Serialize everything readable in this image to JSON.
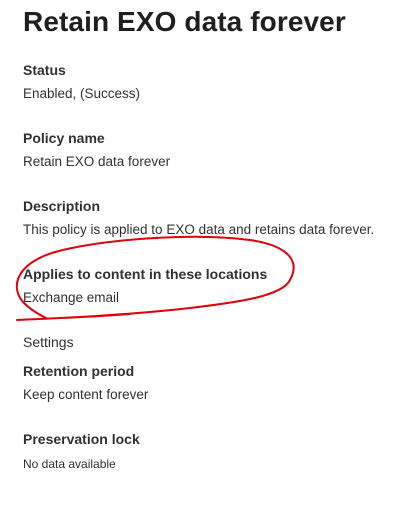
{
  "page": {
    "title": "Retain EXO data forever"
  },
  "fields": {
    "status": {
      "label": "Status",
      "value": "Enabled, (Success)"
    },
    "policy_name": {
      "label": "Policy name",
      "value": "Retain EXO data forever"
    },
    "description": {
      "label": "Description",
      "value": "This policy is applied to EXO data and retains data forever."
    },
    "locations": {
      "label": "Applies to content in these locations",
      "value": "Exchange email"
    }
  },
  "settings": {
    "heading": "Settings",
    "retention_period": {
      "label": "Retention period",
      "value": "Keep content forever"
    },
    "preservation_lock": {
      "label": "Preservation lock",
      "value": "No data available"
    }
  },
  "annotation": {
    "color": "#e0000a"
  }
}
